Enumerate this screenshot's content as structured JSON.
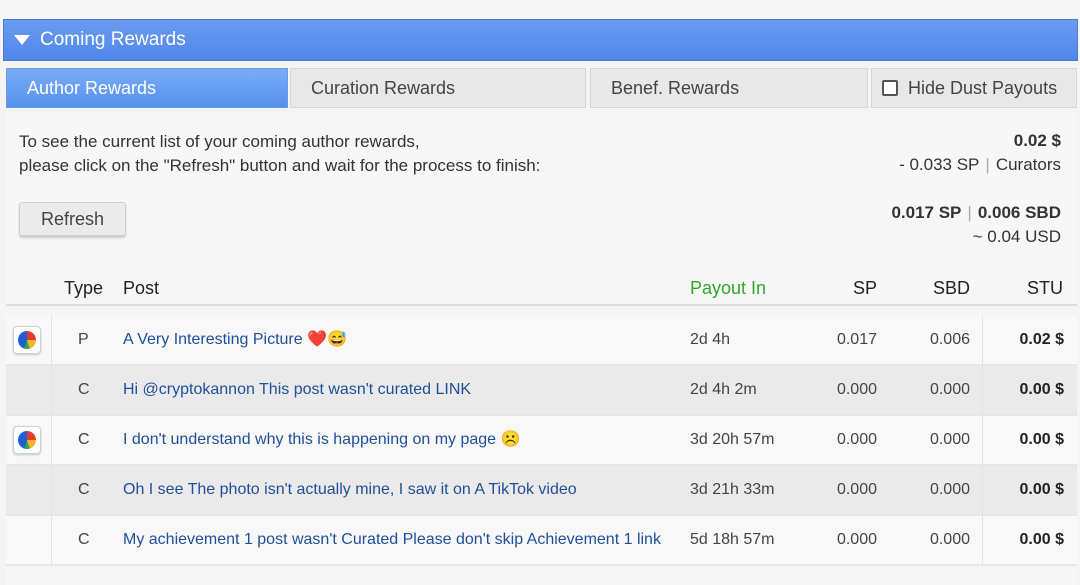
{
  "header": {
    "title": "Coming Rewards"
  },
  "tabs": [
    {
      "label": "Author Rewards",
      "active": true
    },
    {
      "label": "Curation Rewards",
      "active": false
    },
    {
      "label": "Benef. Rewards",
      "active": false
    }
  ],
  "hide_dust": {
    "label": "Hide Dust Payouts",
    "checked": false
  },
  "info": {
    "line1": "To see the current list of your coming author rewards,",
    "line2": "please click on the \"Refresh\" button and wait for the process to finish:"
  },
  "refresh_label": "Refresh",
  "summary": {
    "total": "0.02 $",
    "curators_amount": "- 0.033 SP",
    "curators_label": "Curators",
    "sp": "0.017 SP",
    "sbd": "0.006 SBD",
    "usd": "~ 0.04 USD",
    "separator": "|"
  },
  "table": {
    "headers": {
      "type": "Type",
      "post": "Post",
      "payout": "Payout In",
      "sp": "SP",
      "sbd": "SBD",
      "stu": "STU"
    },
    "rows": [
      {
        "has_chart": true,
        "type": "P",
        "post": "A Very Interesting Picture ❤️😅",
        "payout": "2d 4h",
        "sp": "0.017",
        "sbd": "0.006",
        "stu": "0.02 $"
      },
      {
        "has_chart": false,
        "type": "C",
        "post": "Hi @cryptokannon This post wasn't curated LINK",
        "payout": "2d 4h 2m",
        "sp": "0.000",
        "sbd": "0.000",
        "stu": "0.00 $"
      },
      {
        "has_chart": true,
        "type": "C",
        "post": "I don't understand why this is happening on my page ☹️",
        "payout": "3d 20h 57m",
        "sp": "0.000",
        "sbd": "0.000",
        "stu": "0.00 $"
      },
      {
        "has_chart": false,
        "type": "C",
        "post": "Oh I see The photo isn't actually mine, I saw it on A TikTok video",
        "payout": "3d 21h 33m",
        "sp": "0.000",
        "sbd": "0.000",
        "stu": "0.00 $"
      },
      {
        "has_chart": false,
        "type": "C",
        "post": "My achievement 1 post wasn't Curated Please don't skip Achievement 1 link",
        "payout": "5d 18h 57m",
        "sp": "0.000",
        "sbd": "0.000",
        "stu": "0.00 $"
      }
    ]
  },
  "colors": {
    "header": "#5a90ec",
    "active_tab": "#5f98ef",
    "payout_header": "#2ea82e",
    "link": "#1e4f9a"
  }
}
